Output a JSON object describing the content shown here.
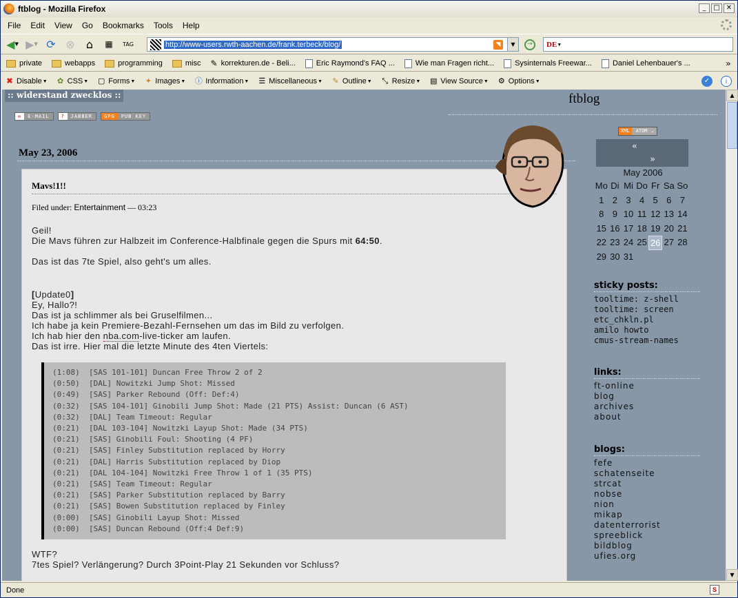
{
  "window": {
    "title": "ftblog - Mozilla Firefox"
  },
  "menu": [
    "File",
    "Edit",
    "View",
    "Go",
    "Bookmarks",
    "Tools",
    "Help"
  ],
  "url": "http://www-users.rwth-aachen.de/frank.terbeck/blog/",
  "search": {
    "engine_label": "DE"
  },
  "bookmarks": [
    {
      "label": "private",
      "type": "folder"
    },
    {
      "label": "webapps",
      "type": "folder"
    },
    {
      "label": "programming",
      "type": "folder"
    },
    {
      "label": "misc",
      "type": "folder"
    },
    {
      "label": "korrekturen.de - Beli...",
      "type": "page"
    },
    {
      "label": "Eric Raymond's FAQ ...",
      "type": "page"
    },
    {
      "label": "Wie man Fragen richt...",
      "type": "page"
    },
    {
      "label": "Sysinternals Freewar...",
      "type": "page"
    },
    {
      "label": "Daniel Lehenbauer's ...",
      "type": "page"
    }
  ],
  "devtools": [
    "Disable",
    "CSS",
    "Forms",
    "Images",
    "Information",
    "Miscellaneous",
    "Outline",
    "Resize",
    "View Source",
    "Options"
  ],
  "status": "Done",
  "page": {
    "site_tag": ":: widerstand zwecklos ::",
    "site_title": "ftblog",
    "badges": [
      {
        "left": "✉",
        "right": "E-MAIL"
      },
      {
        "left": "?",
        "right": "JABBER"
      },
      {
        "left": "GPG",
        "right": "PUB KEY"
      }
    ],
    "date": "May 23, 2006",
    "post": {
      "title": "Mavs!1!!",
      "filed_prefix": "Filed under:",
      "category": "Entertainment",
      "time": "— 03:23",
      "p1_line1": "Geil!",
      "p1_line2_pre": "Die Mavs führen zur Halbzeit im Conference-Halbfinale gegen die Spurs mit ",
      "p1_score": "64:50",
      "p1_line2_post": ".",
      "p2": "Das ist das 7te Spiel, also geht's um alles.",
      "update": "Update0",
      "p3_lines": [
        "Ey, Hallo?!",
        "Das ist ja schlimmer als bei Gruselfilmen...",
        "Ich habe ja kein Premiere-Bezahl-Fernsehen um das im Bild zu verfolgen."
      ],
      "p3_line4_pre": "Ich hab hier den ",
      "p3_link": "nba.com",
      "p3_line4_post": "-live-ticker am laufen.",
      "p3_line5": "Das ist irre. Hier mal die letzte Minute des 4ten Viertels:",
      "log": [
        "(1:08)  [SAS 101-101] Duncan Free Throw 2 of 2",
        "(0:50)  [DAL] Nowitzki Jump Shot: Missed",
        "(0:49)  [SAS] Parker Rebound (Off: Def:4)",
        "(0:32)  [SAS 104-101] Ginobili Jump Shot: Made (21 PTS) Assist: Duncan (6 AST)",
        "(0:32)  [DAL] Team Timeout: Regular",
        "(0:21)  [DAL 103-104] Nowitzki Layup Shot: Made (34 PTS)",
        "(0:21)  [SAS] Ginobili Foul: Shooting (4 PF)",
        "(0:21)  [SAS] Finley Substitution replaced by Horry",
        "(0:21)  [DAL] Harris Substitution replaced by Diop",
        "(0:21)  [DAL 104-104] Nowitzki Free Throw 1 of 1 (35 PTS)",
        "(0:21)  [SAS] Team Timeout: Regular",
        "(0:21)  [SAS] Parker Substitution replaced by Barry",
        "(0:21)  [SAS] Bowen Substitution replaced by Finley",
        "(0:00)  [SAS] Ginobili Layup Shot: Missed",
        "(0:00)  [SAS] Duncan Rebound (Off:4 Def:9)"
      ],
      "p4_lines": [
        "WTF?",
        "7tes Spiel? Verlängerung? Durch 3Point-Play 21 Sekunden vor Schluss?"
      ]
    },
    "sidebar": {
      "feed_badge": {
        "left": "XML",
        "right": "ATOM"
      },
      "cal_prev": "«",
      "cal_next": "»",
      "cal_caption": "May 2006",
      "cal_days": [
        "Mo",
        "Di",
        "Mi",
        "Do",
        "Fr",
        "Sa",
        "So"
      ],
      "cal_cells": [
        "1",
        "2",
        "3",
        "4",
        "5",
        "6",
        "7",
        "8",
        "9",
        "10",
        "11",
        "12",
        "13",
        "14",
        "15",
        "16",
        "17",
        "18",
        "19",
        "20",
        "21",
        "22",
        "23",
        "24",
        "25",
        "26",
        "27",
        "28",
        "29",
        "30",
        "31"
      ],
      "cal_today": "26",
      "sticky_title": "sticky posts:",
      "sticky": [
        "tooltime: z-shell",
        "tooltime: screen",
        "etc_chkln.pl",
        "amilo howto",
        "cmus-stream-names"
      ],
      "links_title": "links:",
      "links": [
        "ft-online",
        "blog",
        "archives",
        "about"
      ],
      "blogs_title": "blogs:",
      "blogs": [
        "fefe",
        "schatenseite",
        "strcat",
        "nobse",
        "nion",
        "mikap",
        "datenterrorist",
        "spreeblick",
        "bildblog",
        "ufies.org"
      ]
    }
  }
}
